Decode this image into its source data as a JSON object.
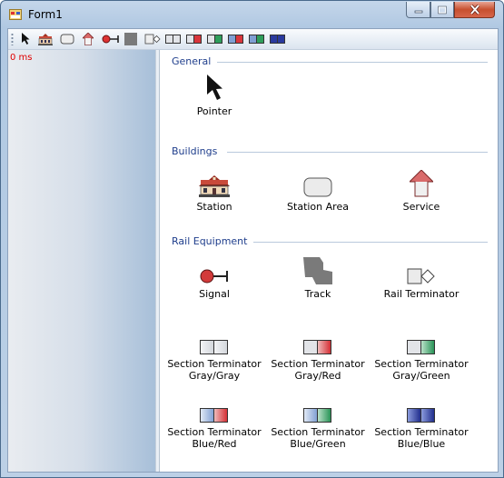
{
  "window": {
    "title": "Form1"
  },
  "status": {
    "elapsed": "0 ms"
  },
  "toolbar": {
    "tools": [
      "pointer-tool",
      "station-tool",
      "station-area-tool",
      "service-tool",
      "signal-tool",
      "track-tool",
      "rail-terminator-tool",
      "section-terminator-gray-gray-tool",
      "section-terminator-gray-red-tool",
      "section-terminator-gray-green-tool",
      "section-terminator-blue-red-tool",
      "section-terminator-blue-green-tool",
      "section-terminator-blue-blue-tool"
    ]
  },
  "toolbox": {
    "groups": [
      {
        "name": "General",
        "items": [
          {
            "label": "Pointer",
            "icon": "pointer-icon"
          }
        ]
      },
      {
        "name": "Buildings",
        "items": [
          {
            "label": "Station",
            "icon": "station-icon"
          },
          {
            "label": "Station Area",
            "icon": "station-area-icon"
          },
          {
            "label": "Service",
            "icon": "service-icon"
          }
        ]
      },
      {
        "name": "Rail Equipment",
        "items": [
          {
            "label": "Signal",
            "icon": "signal-icon"
          },
          {
            "label": "Track",
            "icon": "track-icon"
          },
          {
            "label": "Rail Terminator",
            "icon": "rail-terminator-icon"
          },
          {
            "label": "Section Terminator",
            "sublabel": "Gray/Gray",
            "icon": "section-terminator-icon"
          },
          {
            "label": "Section Terminator",
            "sublabel": "Gray/Red",
            "icon": "section-terminator-icon"
          },
          {
            "label": "Section Terminator",
            "sublabel": "Gray/Green",
            "icon": "section-terminator-icon"
          },
          {
            "label": "Section Terminator",
            "sublabel": "Blue/Red",
            "icon": "section-terminator-icon"
          },
          {
            "label": "Section Terminator",
            "sublabel": "Blue/Green",
            "icon": "section-terminator-icon"
          },
          {
            "label": "Section Terminator",
            "sublabel": "Blue/Blue",
            "icon": "section-terminator-icon"
          }
        ]
      }
    ]
  },
  "colors": {
    "elapsed_text": "#e00000",
    "group_header": "#1f3e8c",
    "gray": "#e2e4e8",
    "red": "#d9353b",
    "green": "#2e9e5b",
    "blue": "#2a3a9e"
  }
}
